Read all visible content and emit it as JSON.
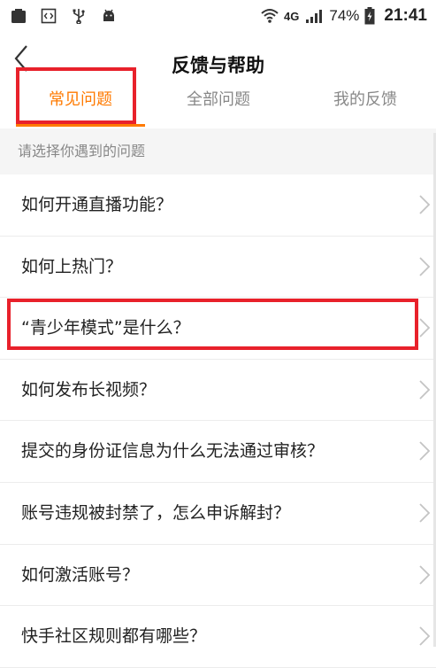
{
  "status_bar": {
    "network": "4G",
    "battery": "74%",
    "time": "21:41"
  },
  "header": {
    "title": "反馈与帮助"
  },
  "tabs": [
    {
      "label": "常见问题",
      "active": true
    },
    {
      "label": "全部问题",
      "active": false
    },
    {
      "label": "我的反馈",
      "active": false
    }
  ],
  "hint": "请选择你遇到的问题",
  "faq": [
    {
      "text": "如何开通直播功能？"
    },
    {
      "text": "如何上热门？"
    },
    {
      "text": "“青少年模式”是什么？"
    },
    {
      "text": "如何发布长视频？"
    },
    {
      "text": "提交的身份证信息为什么无法通过审核？"
    },
    {
      "text": "账号违规被封禁了，怎么申诉解封？"
    },
    {
      "text": "如何激活账号？"
    },
    {
      "text": "快手社区规则都有哪些？"
    }
  ],
  "colors": {
    "accent": "#ff7a00",
    "highlight": "#e8212b"
  }
}
